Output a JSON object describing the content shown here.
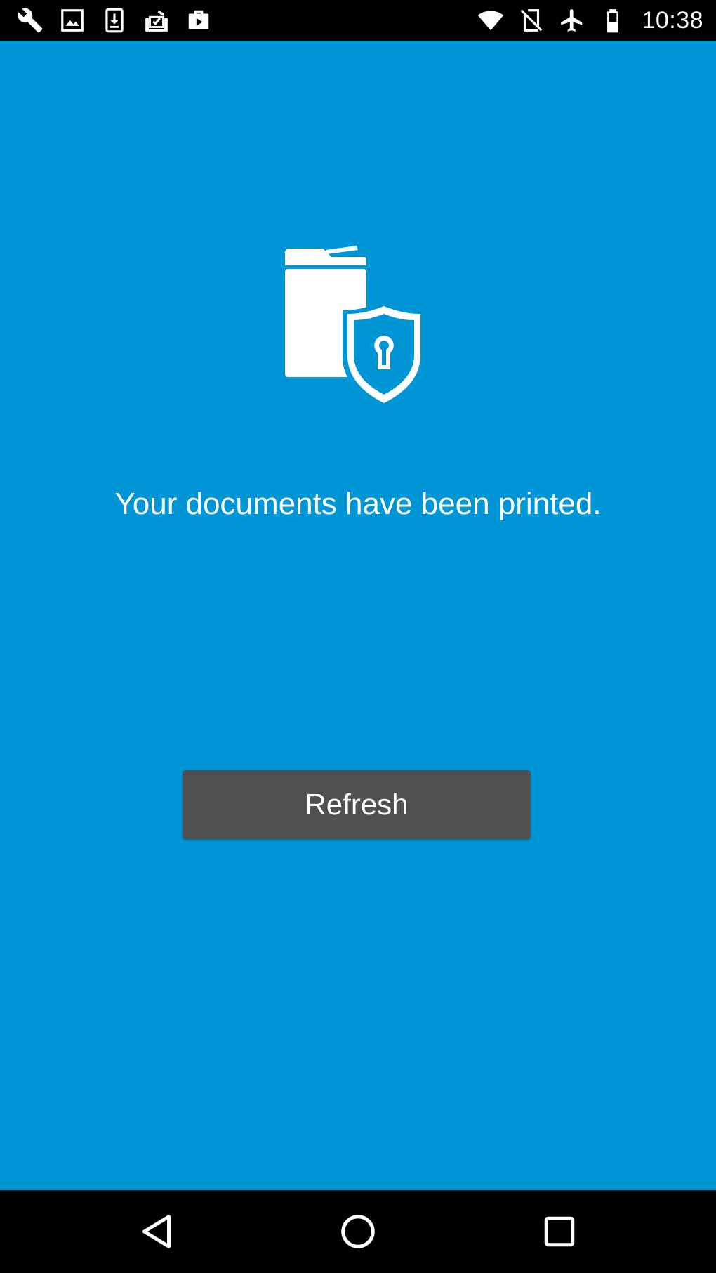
{
  "status_bar": {
    "time": "10:38",
    "left_icons": [
      "wrench-icon",
      "image-icon",
      "download-icon",
      "task-check-icon",
      "briefcase-play-icon"
    ],
    "right_icons": [
      "wifi-icon",
      "no-sim-icon",
      "airplane-mode-icon",
      "battery-icon"
    ]
  },
  "main": {
    "icon": "secure-printer-shield-icon",
    "message": "Your documents have been printed.",
    "refresh_label": "Refresh",
    "background_color": "#0096D6",
    "button_color": "#505050"
  },
  "nav_bar": {
    "buttons": [
      "back-icon",
      "home-icon",
      "recents-icon"
    ]
  }
}
